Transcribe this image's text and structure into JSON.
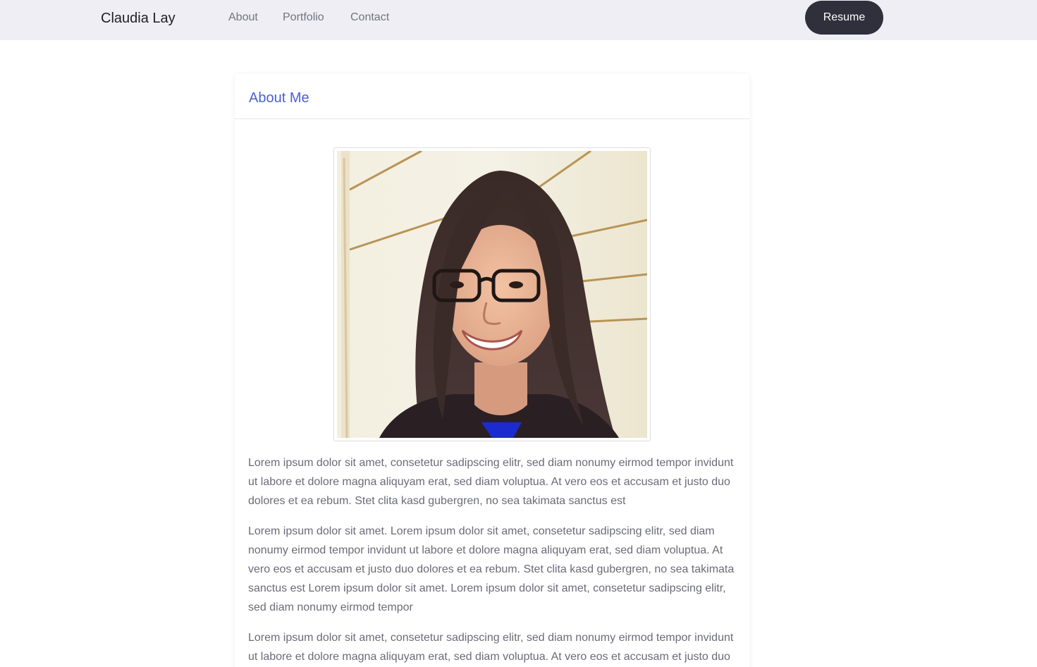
{
  "navbar": {
    "brand": "Claudia Lay",
    "links": [
      {
        "label": "About"
      },
      {
        "label": "Portfolio"
      },
      {
        "label": "Contact"
      }
    ],
    "resume_label": "Resume"
  },
  "about": {
    "title": "About Me",
    "photo_alt": "Portrait of Claudia Lay",
    "paragraphs": [
      "Lorem ipsum dolor sit amet, consetetur sadipscing elitr, sed diam nonumy eirmod tempor invidunt ut labore et dolore magna aliquyam erat, sed diam voluptua. At vero eos et accusam et justo duo dolores et ea rebum. Stet clita kasd gubergren, no sea takimata sanctus est",
      "Lorem ipsum dolor sit amet. Lorem ipsum dolor sit amet, consetetur sadipscing elitr, sed diam nonumy eirmod tempor invidunt ut labore et dolore magna aliquyam erat, sed diam voluptua. At vero eos et accusam et justo duo dolores et ea rebum. Stet clita kasd gubergren, no sea takimata sanctus est Lorem ipsum dolor sit amet. Lorem ipsum dolor sit amet, consetetur sadipscing elitr, sed diam nonumy eirmod tempor",
      "Lorem ipsum dolor sit amet, consetetur sadipscing elitr, sed diam nonumy eirmod tempor invidunt ut labore et dolore magna aliquyam erat, sed diam voluptua. At vero eos et accusam et justo duo dolores et ea rebum. Stet clita kasd gubergren, no sea takimata sanctus est"
    ]
  },
  "colors": {
    "navbar_bg": "#eeeef4",
    "resume_bg": "#302f3c",
    "title_accent": "#4a5fd6",
    "body_text": "#6b6b78"
  }
}
